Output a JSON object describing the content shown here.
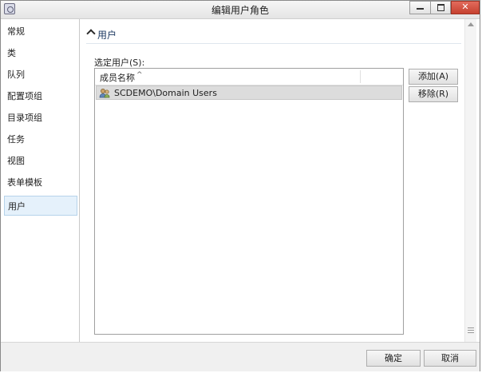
{
  "window": {
    "title": "编辑用户角色"
  },
  "nav": {
    "items": [
      {
        "label": "常规"
      },
      {
        "label": "类"
      },
      {
        "label": "队列"
      },
      {
        "label": "配置项组"
      },
      {
        "label": "目录项组"
      },
      {
        "label": "任务"
      },
      {
        "label": "视图"
      },
      {
        "label": "表单模板"
      },
      {
        "label": "用户",
        "selected": true
      }
    ]
  },
  "section": {
    "title": "用户"
  },
  "users": {
    "field_label": "选定用户(S):",
    "column_header": "成员名称",
    "rows": [
      {
        "name": "SCDEMO\\Domain Users"
      }
    ],
    "add_button": "添加(A)",
    "remove_button": "移除(R)"
  },
  "footer": {
    "ok_button": "确定",
    "cancel_button": "取消"
  },
  "icons": {
    "app": "app-icon",
    "section_toggle": "chevron-up-icon",
    "user_group": "user-group-icon",
    "sort": "sort-ascending-icon"
  },
  "colors": {
    "close_button": "#c6412f",
    "nav_selected": "#e5f1fb",
    "section_title": "#1f3b63"
  }
}
